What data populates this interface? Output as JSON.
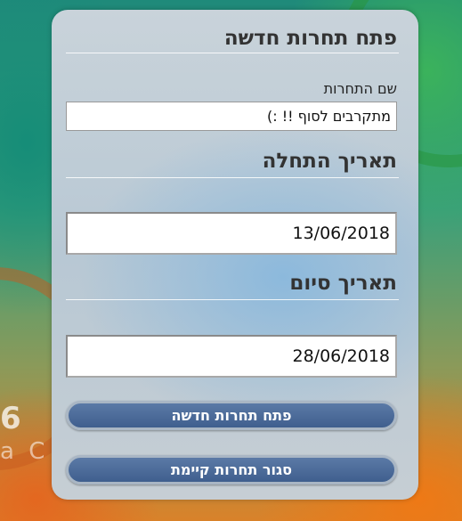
{
  "background": {
    "number_text": "6",
    "letters_text": "a C"
  },
  "panel": {
    "title": "פתח תחרות חדשה",
    "competition_name": {
      "label": "שם התחרות",
      "value": "מתקרבים לסוף !! :)"
    },
    "start_date": {
      "heading": "תאריך התחלה",
      "value": "13/06/2018"
    },
    "end_date": {
      "heading": "תאריך סיום",
      "value": "28/06/2018"
    },
    "buttons": {
      "open_label": "פתח תחרות חדשה",
      "close_label": "סגור תחרות קיימת"
    }
  },
  "colors": {
    "button_bg": "#4a6a99",
    "panel_bg": "#c3cfd8"
  }
}
